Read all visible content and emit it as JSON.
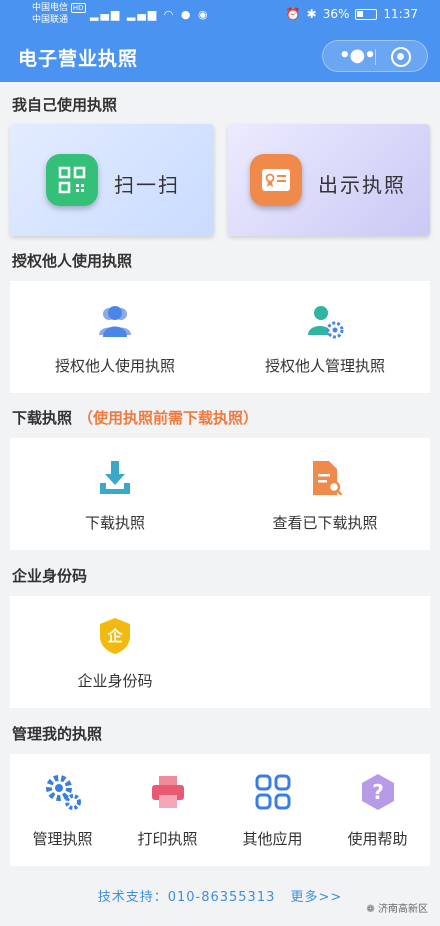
{
  "status_bar": {
    "carrier_1": "中国电信",
    "carrier_2": "中国联通",
    "hd_badge": "HD",
    "signal_text": "⁴ᴳ ᵢₗ ᵢₗ",
    "battery": "36%",
    "time": "11:37"
  },
  "header": {
    "title": "电子营业执照"
  },
  "section_self": {
    "title": "我自己使用执照",
    "scan_label": "扫一扫",
    "show_label": "出示执照"
  },
  "section_authorize": {
    "title": "授权他人使用执照",
    "items": [
      {
        "label": "授权他人使用执照",
        "icon": "people-icon"
      },
      {
        "label": "授权他人管理执照",
        "icon": "user-gear-icon"
      }
    ]
  },
  "section_download": {
    "title": "下载执照",
    "note": "（使用执照前需下载执照）",
    "items": [
      {
        "label": "下载执照",
        "icon": "download-icon"
      },
      {
        "label": "查看已下载执照",
        "icon": "document-search-icon"
      }
    ]
  },
  "section_id": {
    "title": "企业身份码",
    "item_label": "企业身份码",
    "shield_char": "企"
  },
  "section_manage": {
    "title": "管理我的执照",
    "items": [
      {
        "label": "管理执照",
        "icon": "gears-icon"
      },
      {
        "label": "打印执照",
        "icon": "printer-icon"
      },
      {
        "label": "其他应用",
        "icon": "apps-grid-icon"
      },
      {
        "label": "使用帮助",
        "icon": "help-icon"
      }
    ]
  },
  "footer": {
    "support_text": "技术支持：010-86355313",
    "more_link": "更多>>"
  },
  "watermark": "济南高新区",
  "colors": {
    "header_blue": "#4a93f0",
    "scan_green": "#35c07a",
    "license_orange": "#f08a4a",
    "note_orange": "#f07b3f",
    "link_blue": "#3f8fe0"
  }
}
